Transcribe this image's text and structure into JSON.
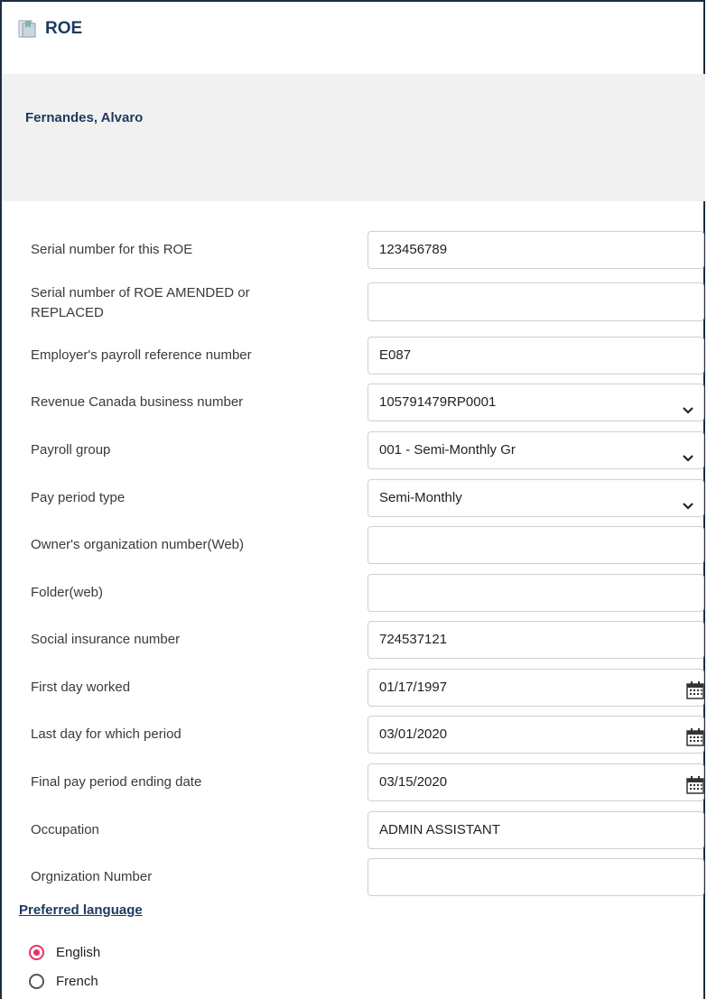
{
  "window": {
    "title": "ROE",
    "icon": "document-icon"
  },
  "employee": {
    "name": "Fernandes, Alvaro"
  },
  "fields": [
    {
      "label": "Serial number for this ROE",
      "value": "123456789",
      "type": "text"
    },
    {
      "label": "Serial number of ROE AMENDED or REPLACED",
      "value": "",
      "type": "text"
    },
    {
      "label": "Employer's payroll reference number",
      "value": "E087",
      "type": "text"
    },
    {
      "label": "Revenue Canada business number",
      "value": "105791479RP0001",
      "type": "select"
    },
    {
      "label": "Payroll group",
      "value": "001 - Semi-Monthly Gr",
      "type": "select"
    },
    {
      "label": "Pay period type",
      "value": "Semi-Monthly",
      "type": "select"
    },
    {
      "label": "Owner's organization number(Web)",
      "value": "",
      "type": "text"
    },
    {
      "label": "Folder(web)",
      "value": "",
      "type": "text"
    },
    {
      "label": "Social insurance number",
      "value": "724537121",
      "type": "text"
    },
    {
      "label": "First day worked",
      "value": "01/17/1997",
      "type": "date"
    },
    {
      "label": "Last day for which period",
      "value": "03/01/2020",
      "type": "date"
    },
    {
      "label": "Final pay period ending date",
      "value": "03/15/2020",
      "type": "date"
    },
    {
      "label": "Occupation",
      "value": "ADMIN ASSISTANT",
      "type": "text"
    },
    {
      "label": "Orgnization Number",
      "value": "",
      "type": "text"
    }
  ],
  "preferred_language": {
    "title": "Preferred language",
    "options": [
      {
        "label": "English",
        "selected": true
      },
      {
        "label": "French",
        "selected": false
      }
    ]
  },
  "colors": {
    "accent": "#e8336a",
    "heading": "#1c3a5e",
    "band": "#f1f1f1"
  }
}
